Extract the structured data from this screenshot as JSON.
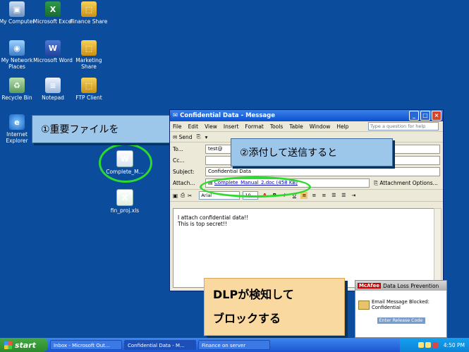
{
  "desktop_icons": [
    {
      "label": "My Computer",
      "glyph": "▣",
      "icon": "my-computer-icon"
    },
    {
      "label": "Microsoft Excel",
      "glyph": "X",
      "icon": "excel-icon"
    },
    {
      "label": "Finance Share",
      "glyph": "⬚",
      "icon": "folder-share-icon"
    },
    {
      "label": "My Network Places",
      "glyph": "◉",
      "icon": "network-icon"
    },
    {
      "label": "Microsoft Word",
      "glyph": "W",
      "icon": "word-icon"
    },
    {
      "label": "Marketing Share",
      "glyph": "⬚",
      "icon": "folder-share-icon"
    },
    {
      "label": "Recycle Bin",
      "glyph": "♻",
      "icon": "recycle-bin-icon"
    },
    {
      "label": "Notepad",
      "glyph": "≡",
      "icon": "notepad-icon"
    },
    {
      "label": "FTP Client",
      "glyph": "⬚",
      "icon": "ftp-client-icon"
    },
    {
      "label": "Internet Explorer",
      "glyph": "e",
      "icon": "internet-explorer-icon"
    },
    {
      "label": "Complete_M...",
      "glyph": "W",
      "icon": "word-document-icon"
    },
    {
      "label": "fin_proj.xls",
      "glyph": "X",
      "icon": "excel-file-icon"
    }
  ],
  "callouts": {
    "step1": "①重要ファイルを",
    "step2": "②添付して送信すると",
    "step3_line1": "DLPが検知して",
    "step3_line2": "ブロックする"
  },
  "email_window": {
    "title": "Confidential Data - Message",
    "menu": [
      "File",
      "Edit",
      "View",
      "Insert",
      "Format",
      "Tools",
      "Table",
      "Window",
      "Help"
    ],
    "help_placeholder": "Type a question for help",
    "send_label": "Send",
    "fields": {
      "to_label": "To...",
      "to_value": "test@",
      "cc_label": "Cc...",
      "cc_value": "",
      "subject_label": "Subject:",
      "subject_value": "Confidential Data",
      "attach_label": "Attach...",
      "attachment": "Complete_Manual_2.doc (458 KB)",
      "attachment_options": "Attachment Options..."
    },
    "format": {
      "font": "Arial",
      "size": "10"
    },
    "body_lines": [
      "I attach confidential data!!",
      "This is top secret!!"
    ]
  },
  "mcafee": {
    "brand": "McAfee",
    "title": "Data Loss Prevention",
    "message": "Email Message Blocked: Confidential",
    "button": "Enter Release Code"
  },
  "taskbar": {
    "start": "start",
    "tasks": [
      "Inbox - Microsoft Out...",
      "Confidential Data - M...",
      "Finance on server"
    ],
    "time": "4:50 PM"
  }
}
